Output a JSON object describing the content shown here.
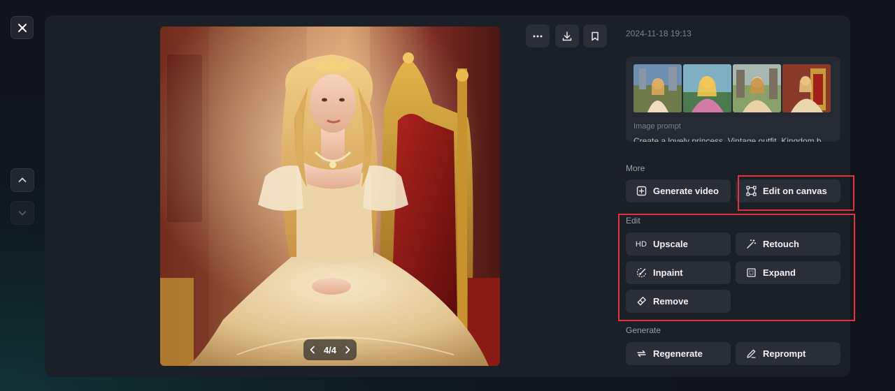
{
  "toolbar": {
    "close_icon": "close-icon",
    "more_icon": "more-dots-icon",
    "download_icon": "download-icon",
    "bookmark_icon": "bookmark-icon"
  },
  "navigation": {
    "up_icon": "chevron-up-icon",
    "down_icon": "chevron-down-icon"
  },
  "viewer": {
    "pager_label": "4/4"
  },
  "details": {
    "timestamp": "2024-11-18 19:13",
    "prompt_label": "Image prompt",
    "prompt_text": "Create a lovely princess. Vintage outfit. Kingdom b"
  },
  "more": {
    "label": "More",
    "generate_video": "Generate video",
    "edit_on_canvas": "Edit on canvas"
  },
  "edit": {
    "label": "Edit",
    "upscale_badge": "HD",
    "upscale": "Upscale",
    "retouch": "Retouch",
    "inpaint": "Inpaint",
    "expand": "Expand",
    "remove": "Remove"
  },
  "generate": {
    "label": "Generate",
    "regenerate": "Regenerate",
    "reprompt": "Reprompt"
  },
  "colors": {
    "panel": "#1b1f26",
    "button": "#2a2f37",
    "highlight": "#e5303f"
  }
}
